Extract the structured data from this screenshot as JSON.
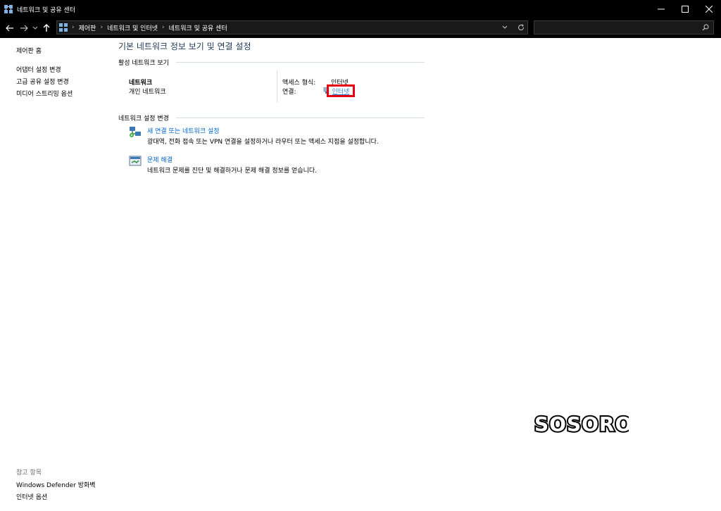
{
  "window": {
    "title": "네트워크 및 공유 센터"
  },
  "navigation": {
    "breadcrumbs": [
      "제어판",
      "네트워크 및 인터넷",
      "네트워크 및 공유 센터"
    ]
  },
  "sidebar": {
    "home_link": "제어판 홈",
    "links": [
      "어댑터 설정 변경",
      "고급 공유 설정 변경",
      "미디어 스트리밍 옵션"
    ],
    "see_also_heading": "참고 항목",
    "see_also_links": [
      "Windows Defender 방화벽",
      "인터넷 옵션"
    ]
  },
  "main": {
    "title": "기본 네트워크 정보 보기 및 연결 설정",
    "active_networks": {
      "heading": "활성 네트워크 보기",
      "network_name": "네트워크",
      "network_type": "개인 네트워크",
      "access_type_label": "액세스 형식:",
      "access_type_value": "인터넷",
      "connection_label": "연결:",
      "connection_link": "인터넷"
    },
    "change_settings": {
      "heading": "네트워크 설정 변경",
      "tasks": [
        {
          "link": "새 연결 또는 네트워크 설정",
          "description": "광대역, 전화 접속 또는 VPN 연결을 설정하거나 라우터 또는 액세스 지점을 설정합니다."
        },
        {
          "link": "문제 해결",
          "description": "네트워크 문제를 진단 및 해결하거나 문제 해결 정보를 얻습니다."
        }
      ]
    }
  },
  "watermark": {
    "text": "SOSORO"
  },
  "colors": {
    "titlebar_bg": "#000000",
    "link": "#0066cc",
    "main_title": "#1e395b",
    "highlight_box": "#e60012"
  }
}
